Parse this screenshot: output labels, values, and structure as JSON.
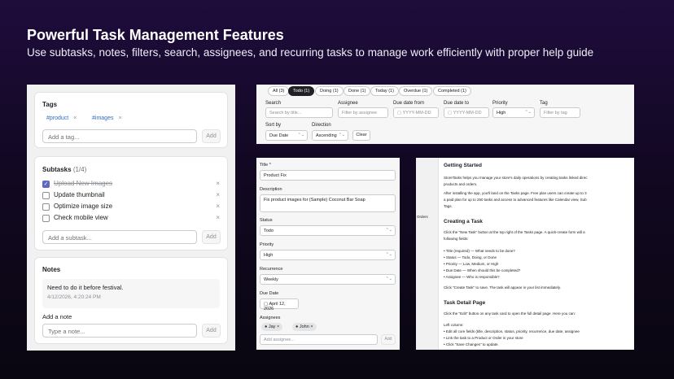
{
  "hero": {
    "title": "Powerful Task Management Features",
    "subtitle": "Use subtasks, notes, filters, search, assignees, and recurring tasks to manage work efficiently with proper help guide"
  },
  "tags": {
    "title": "Tags",
    "items": [
      "#product",
      "#images"
    ],
    "remove_glyph": "×",
    "placeholder": "Add a tag...",
    "add_label": "Add"
  },
  "subtasks": {
    "title": "Subtasks",
    "count": "(1/4)",
    "items": [
      {
        "label": "Upload New Images",
        "done": true
      },
      {
        "label": "Update thumbnail",
        "done": false
      },
      {
        "label": "Optimize image size",
        "done": false
      },
      {
        "label": "Check mobile view",
        "done": false
      }
    ],
    "check_glyph": "✓",
    "placeholder": "Add a subtask...",
    "add_label": "Add"
  },
  "notes": {
    "title": "Notes",
    "entry_text": "Need to do it before festival.",
    "entry_time": "4/12/2026, 4:20:24 PM",
    "add_label_title": "Add a note",
    "placeholder": "Type a note...",
    "add_label": "Add"
  },
  "filters": {
    "tabs": [
      {
        "label": "All (3)",
        "active": false
      },
      {
        "label": "Todo (1)",
        "active": true
      },
      {
        "label": "Doing (1)",
        "active": false
      },
      {
        "label": "Done (1)",
        "active": false
      },
      {
        "label": "Today (1)",
        "active": false
      },
      {
        "label": "Overdue (1)",
        "active": false
      },
      {
        "label": "Completed (1)",
        "active": false
      }
    ],
    "search_label": "Search",
    "search_placeholder": "Search by title...",
    "assignee_label": "Assignee",
    "assignee_placeholder": "Filter by assignee",
    "due_from_label": "Due date from",
    "due_to_label": "Due date to",
    "date_placeholder": "YYYY-MM-DD",
    "priority_label": "Priority",
    "priority_value": "High",
    "tag_label": "Tag",
    "tag_placeholder": "Filter by tag",
    "sort_label": "Sort by",
    "sort_value": "Due Date",
    "direction_label": "Direction",
    "direction_value": "Ascending",
    "clear_label": "Clear",
    "calendar_glyph": "▢",
    "chevron_glyph": "⌃⌄"
  },
  "form": {
    "title_label": "Title *",
    "title_value": "Product Fix",
    "description_label": "Description",
    "description_value": "Fix product images for (Sample) Coconut Bar Soap",
    "status_label": "Status",
    "status_value": "Todo",
    "priority_label": "Priority",
    "priority_value": "High",
    "recurrence_label": "Recurrence",
    "recurrence_value": "Weekly",
    "due_label": "Due Date",
    "due_value": "April 12, 2026",
    "assignees_label": "Assignees",
    "assignees": [
      "Jay",
      "John"
    ],
    "assignee_placeholder": "Add assignee...",
    "add_label": "Add",
    "chevron_glyph": "⌃⌄"
  },
  "help": {
    "sidebar_label": "Orders",
    "blocks": [
      {
        "kind": "title",
        "text": "Getting Started"
      },
      {
        "kind": "text",
        "text": "StoreTasks helps you manage your store's daily operations by creating tasks linked direc"
      },
      {
        "kind": "text",
        "text": "products and orders."
      },
      {
        "kind": "text",
        "text": "After installing the app, you'll land on the Tasks page. Free plan users can create up to 3"
      },
      {
        "kind": "text",
        "text": "a paid plan for up to 250 tasks and access to advanced features like Calendar view, Sub"
      },
      {
        "kind": "text",
        "text": "Tags."
      },
      {
        "kind": "title",
        "text": "Creating a Task"
      },
      {
        "kind": "text",
        "text": "Click the \"New Task\" button at the top right of the Tasks page. A quick-create form will a"
      },
      {
        "kind": "text",
        "text": "following fields:"
      },
      {
        "kind": "text",
        "text": "• Title (required) — What needs to be done?"
      },
      {
        "kind": "text",
        "text": "• Status — Todo, Doing, or Done"
      },
      {
        "kind": "text",
        "text": "• Priority — Low, Medium, or High"
      },
      {
        "kind": "text",
        "text": "• Due Date — When should this be completed?"
      },
      {
        "kind": "text",
        "text": "• Assignee — Who is responsible?"
      },
      {
        "kind": "text",
        "text": "Click \"Create Task\" to save. The task will appear in your list immediately."
      },
      {
        "kind": "title",
        "text": "Task Detail Page"
      },
      {
        "kind": "text",
        "text": "Click the \"Edit\" button on any task card to open the full detail page. Here you can:"
      },
      {
        "kind": "text",
        "text": "Left column:"
      },
      {
        "kind": "text",
        "text": "• Edit all core fields (title, description, status, priority, recurrence, due date, assignee"
      },
      {
        "kind": "text",
        "text": "• Link the task to a Product or Order in your store"
      },
      {
        "kind": "text",
        "text": "• Click \"Save Changes\" to update."
      }
    ]
  }
}
